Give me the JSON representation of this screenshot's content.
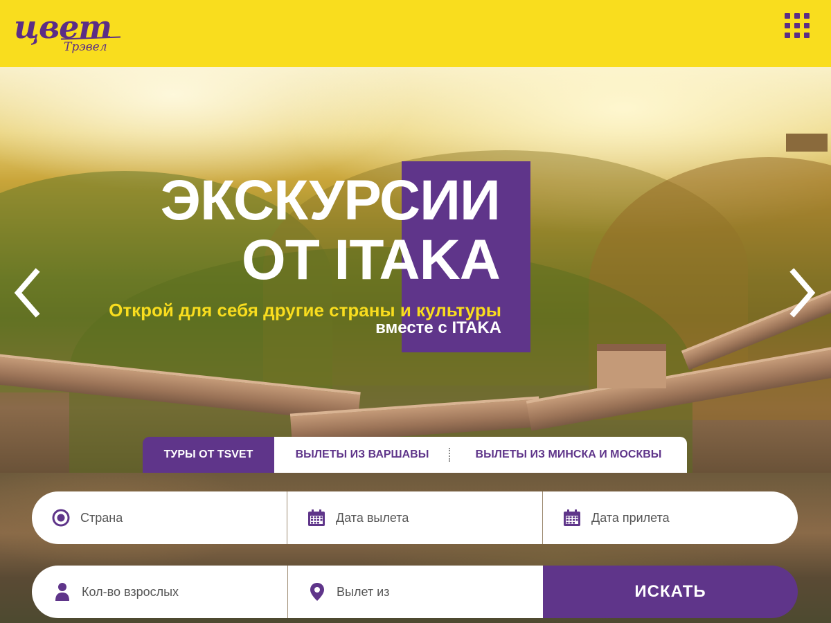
{
  "brand": {
    "logo_main": "цвет",
    "logo_sub": "Трэвел"
  },
  "hero": {
    "title_line1": "ЭКСКУРСИИ",
    "title_line2": "ОТ ITAKA",
    "subtitle_line1": "Открой для себя другие страны и культуры",
    "subtitle_line2": "вместе с ITAKA"
  },
  "tabs": [
    {
      "label": "ТУРЫ ОТ TSVET",
      "active": true
    },
    {
      "label": "ВЫЛЕТЫ ИЗ ВАРШАВЫ",
      "active": false
    },
    {
      "label": "ВЫЛЕТЫ ИЗ МИНСКА И МОСКВЫ",
      "active": false
    }
  ],
  "search": {
    "country": "Страна",
    "departure_date": "Дата вылета",
    "arrival_date": "Дата прилета",
    "adults": "Кол-во взрослых",
    "departure_from": "Вылет из",
    "submit_label": "ИСКАТЬ"
  },
  "icons": {
    "menu": "grid-menu-icon",
    "prev": "chevron-left-icon",
    "next": "chevron-right-icon",
    "country": "target-icon",
    "date": "calendar-icon",
    "adults": "person-icon",
    "from": "map-pin-icon"
  },
  "colors": {
    "header_bg": "#f9dd1e",
    "brand_purple": "#5f358a",
    "accent_yellow": "#f9dd1e"
  }
}
